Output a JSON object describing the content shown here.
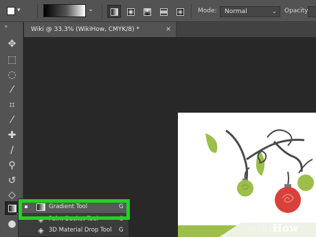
{
  "options_bar": {
    "tool_preset_icon": "gradient-tool-preset-icon",
    "gradient_picker_icon": "gradient-swatch",
    "gradient_types": [
      {
        "name": "linear-gradient-icon",
        "active": true
      },
      {
        "name": "radial-gradient-icon",
        "active": false
      },
      {
        "name": "angle-gradient-icon",
        "active": false
      },
      {
        "name": "reflected-gradient-icon",
        "active": false
      },
      {
        "name": "diamond-gradient-icon",
        "active": false
      }
    ],
    "mode_label": "Mode:",
    "mode_value": "Normal",
    "opacity_label": "Opacity:"
  },
  "toolbar": {
    "collapse_glyph": "»",
    "tools": [
      {
        "name": "move-tool-icon",
        "glyph": "✥"
      },
      {
        "name": "marquee-tool-icon",
        "glyph": "⬚"
      },
      {
        "name": "lasso-tool-icon",
        "glyph": "◌"
      },
      {
        "name": "quick-selection-tool-icon",
        "glyph": "⁄"
      },
      {
        "name": "crop-tool-icon",
        "glyph": "⌗"
      },
      {
        "name": "eyedropper-tool-icon",
        "glyph": "⁄"
      },
      {
        "name": "healing-brush-tool-icon",
        "glyph": "✚"
      },
      {
        "name": "brush-tool-icon",
        "glyph": "/"
      },
      {
        "name": "clone-stamp-tool-icon",
        "glyph": "⚲"
      },
      {
        "name": "history-brush-tool-icon",
        "glyph": "↺"
      },
      {
        "name": "eraser-tool-icon",
        "glyph": "◇"
      },
      {
        "name": "gradient-tool-icon",
        "glyph": ""
      },
      {
        "name": "blur-tool-icon",
        "glyph": "●"
      }
    ]
  },
  "document_tab": {
    "title": "Wiki @ 33.3% (WikiHow, CMYK/8) *",
    "close_glyph": "×"
  },
  "flyout": {
    "items": [
      {
        "label": "Gradient Tool",
        "shortcut": "G",
        "icon": "gradient-icon",
        "selected": true
      },
      {
        "label": "Paint Bucket Tool",
        "shortcut": "G",
        "icon": "paint-bucket-icon",
        "selected": false
      },
      {
        "label": "3D Material Drop Tool",
        "shortcut": "G",
        "icon": "3d-material-drop-icon",
        "selected": false
      }
    ],
    "highlight_color": "#22d41d"
  },
  "watermark": {
    "part1": "wiki",
    "part2": "How"
  },
  "colors": {
    "ui_panel": "#535353",
    "canvas_bg": "#282828",
    "document": "#ffffff",
    "ornament_green": "#9bbf4a",
    "ornament_red": "#d9403a",
    "branch": "#4a4a4a"
  }
}
